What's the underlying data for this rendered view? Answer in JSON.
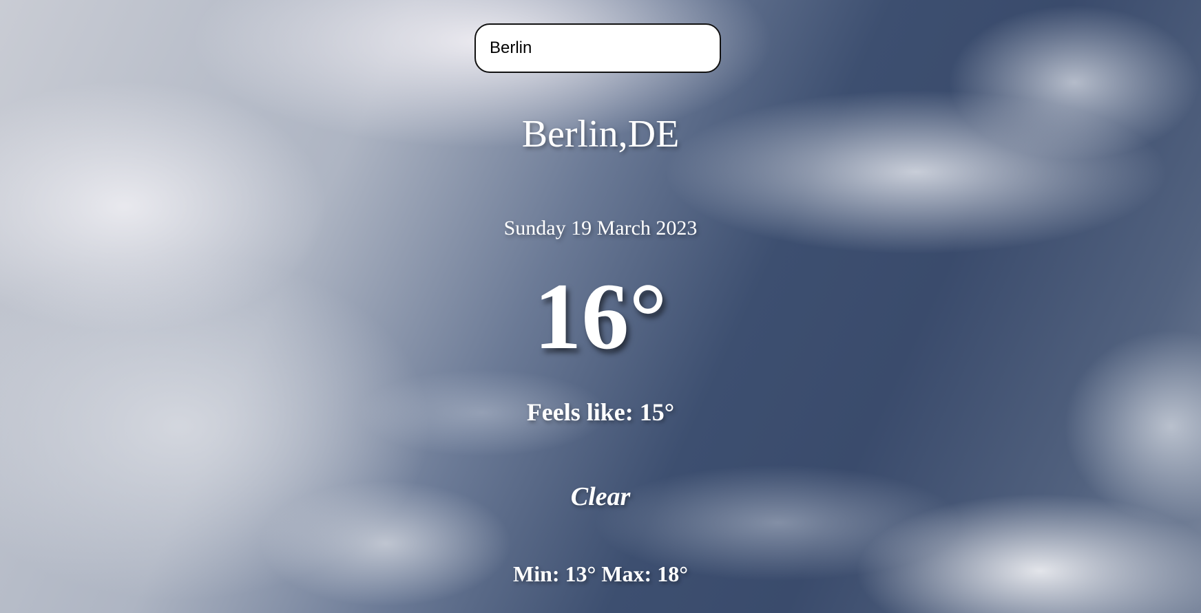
{
  "search": {
    "value": "Berlin",
    "placeholder": ""
  },
  "weather": {
    "location": "Berlin,DE",
    "date": "Sunday 19 March 2023",
    "temperature": "16°",
    "feels_like": "Feels like: 15°",
    "condition": "Clear",
    "min_max": "Min: 13° Max: 18°"
  },
  "colors": {
    "text": "#ffffff",
    "input_border": "#111111",
    "input_background": "#ffffff"
  }
}
